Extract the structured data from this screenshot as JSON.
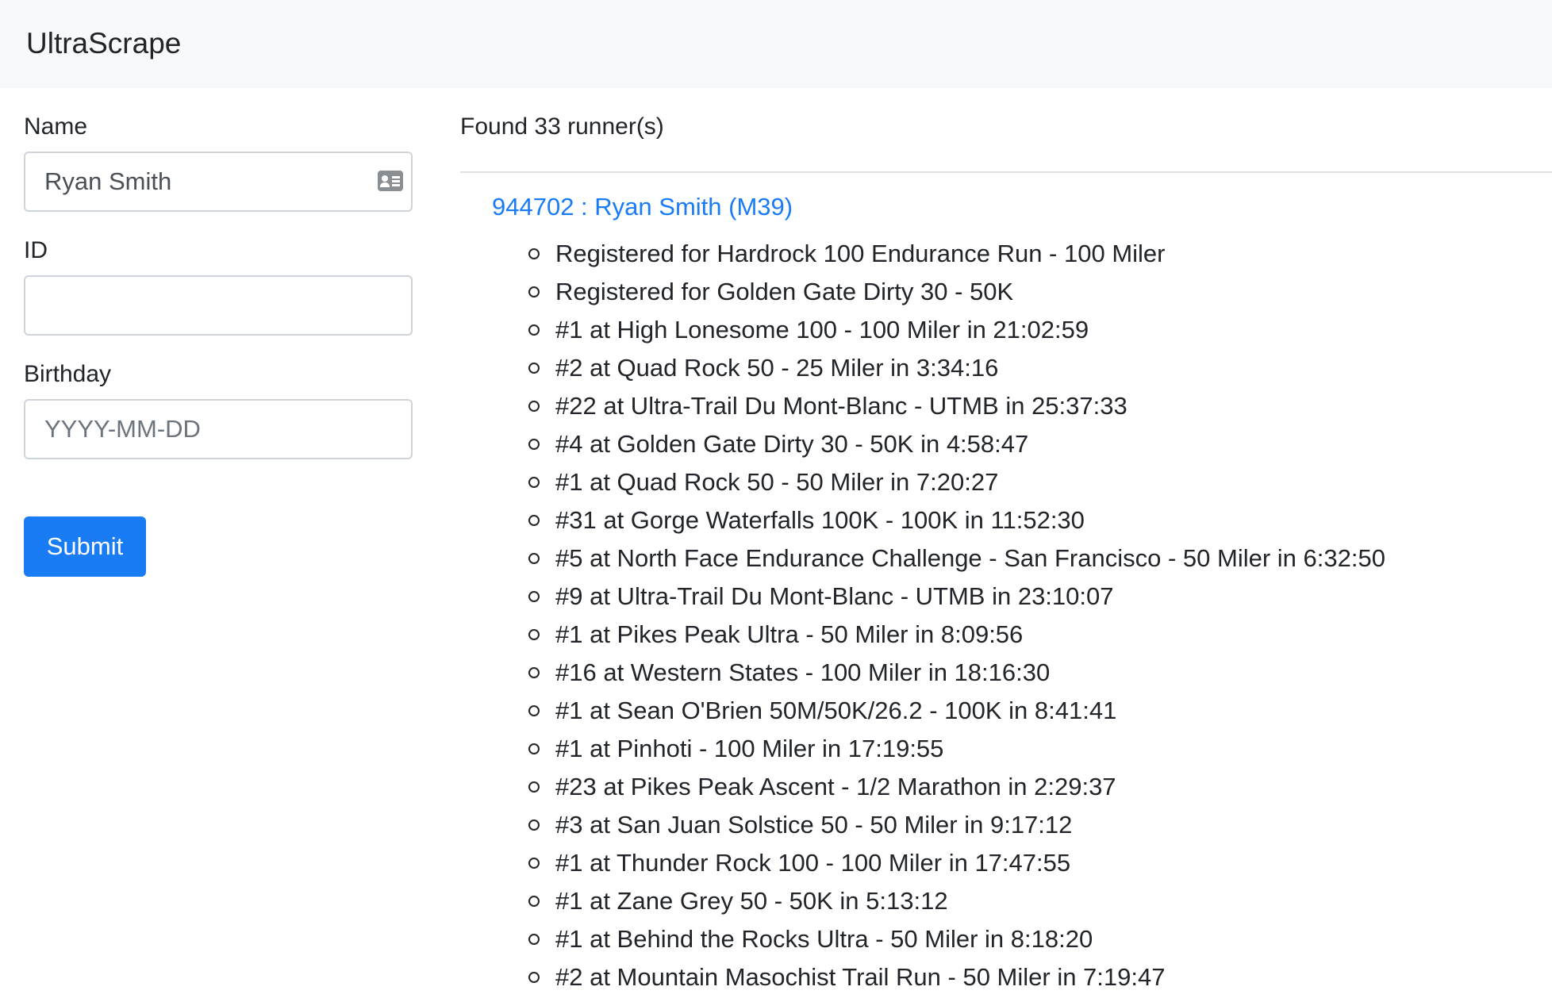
{
  "app": {
    "brand": "UltraScrape"
  },
  "form": {
    "name": {
      "label": "Name",
      "value": "Ryan Smith",
      "placeholder": ""
    },
    "id": {
      "label": "ID",
      "value": "",
      "placeholder": ""
    },
    "birthday": {
      "label": "Birthday",
      "value": "",
      "placeholder": "YYYY-MM-DD"
    },
    "submit_label": "Submit",
    "name_field_icon": "contact-card-icon"
  },
  "results": {
    "summary": "Found 33 runner(s)",
    "runners": [
      {
        "title": "944702 : Ryan Smith (M39)",
        "races": [
          "Registered for Hardrock 100 Endurance Run - 100 Miler",
          "Registered for Golden Gate Dirty 30 - 50K",
          "#1 at High Lonesome 100 - 100 Miler in 21:02:59",
          "#2 at Quad Rock 50 - 25 Miler in 3:34:16",
          "#22 at Ultra-Trail Du Mont-Blanc - UTMB in 25:37:33",
          "#4 at Golden Gate Dirty 30 - 50K in 4:58:47",
          "#1 at Quad Rock 50 - 50 Miler in 7:20:27",
          "#31 at Gorge Waterfalls 100K - 100K in 11:52:30",
          "#5 at North Face Endurance Challenge - San Francisco - 50 Miler in 6:32:50",
          "#9 at Ultra-Trail Du Mont-Blanc - UTMB in 23:10:07",
          "#1 at Pikes Peak Ultra - 50 Miler in 8:09:56",
          "#16 at Western States - 100 Miler in 18:16:30",
          "#1 at Sean O'Brien 50M/50K/26.2 - 100K in 8:41:41",
          "#1 at Pinhoti - 100 Miler in 17:19:55",
          "#23 at Pikes Peak Ascent - 1/2 Marathon in 2:29:37",
          "#3 at San Juan Solstice 50 - 50 Miler in 9:17:12",
          "#1 at Thunder Rock 100 - 100 Miler in 17:47:55",
          "#1 at Zane Grey 50 - 50K in 5:13:12",
          "#1 at Behind the Rocks Ultra - 50 Miler in 8:18:20",
          "#2 at Mountain Masochist Trail Run - 50 Miler in 7:19:47"
        ]
      }
    ]
  }
}
